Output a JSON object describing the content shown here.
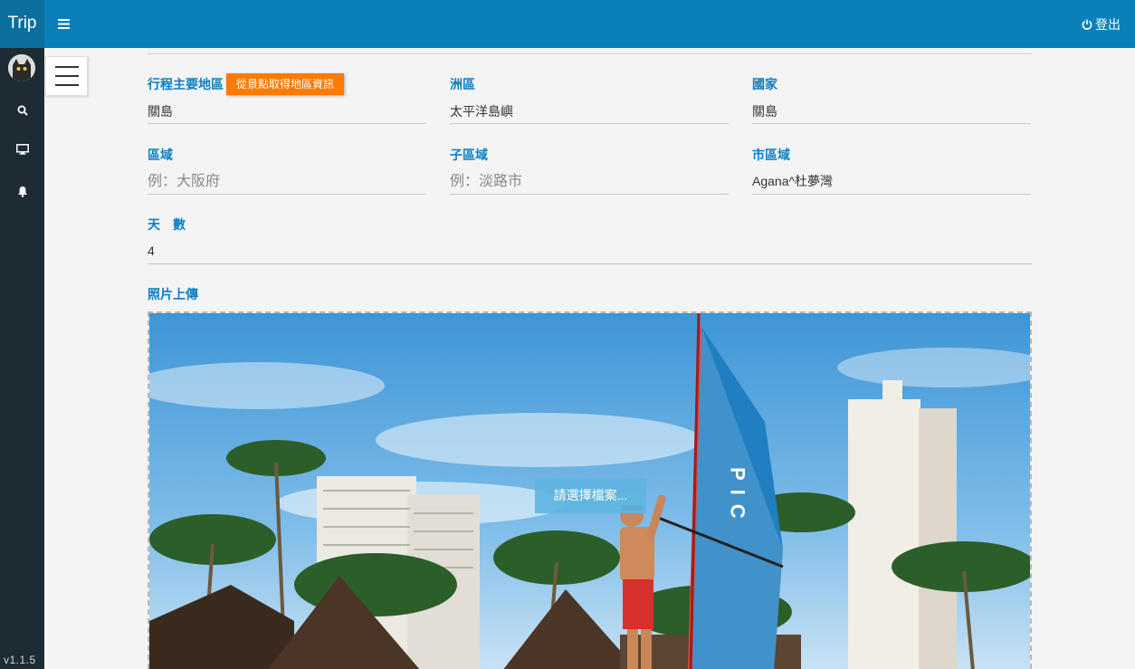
{
  "app": {
    "brand": "Trip",
    "version": "v1.1.5"
  },
  "header": {
    "logout_label": "登出"
  },
  "sidebar": {
    "icons": [
      "search-icon",
      "desktop-icon",
      "bell-icon"
    ]
  },
  "form": {
    "region_main": {
      "label": "行程主要地區",
      "value": "關島",
      "geo_button": "從景點取得地區資訊"
    },
    "continent": {
      "label": "洲區",
      "value": "太平洋島嶼"
    },
    "country": {
      "label": "國家",
      "value": "關島"
    },
    "area": {
      "label": "區域",
      "placeholder": "例：大阪府",
      "value": ""
    },
    "sub_area": {
      "label": "子區域",
      "placeholder": "例：淡路市",
      "value": ""
    },
    "city_area": {
      "label": "市區域",
      "value": "Agana^杜夢灣"
    },
    "days": {
      "label": "天　數",
      "value": "4"
    },
    "photo": {
      "label": "照片上傳",
      "choose_button": "請選擇檔案...",
      "sail_text": "PIC"
    }
  },
  "colors": {
    "topbar": "#0a80b8",
    "sidebar": "#1d2b35",
    "accent": "#0a7ec2",
    "orange": "#ff7a00"
  }
}
